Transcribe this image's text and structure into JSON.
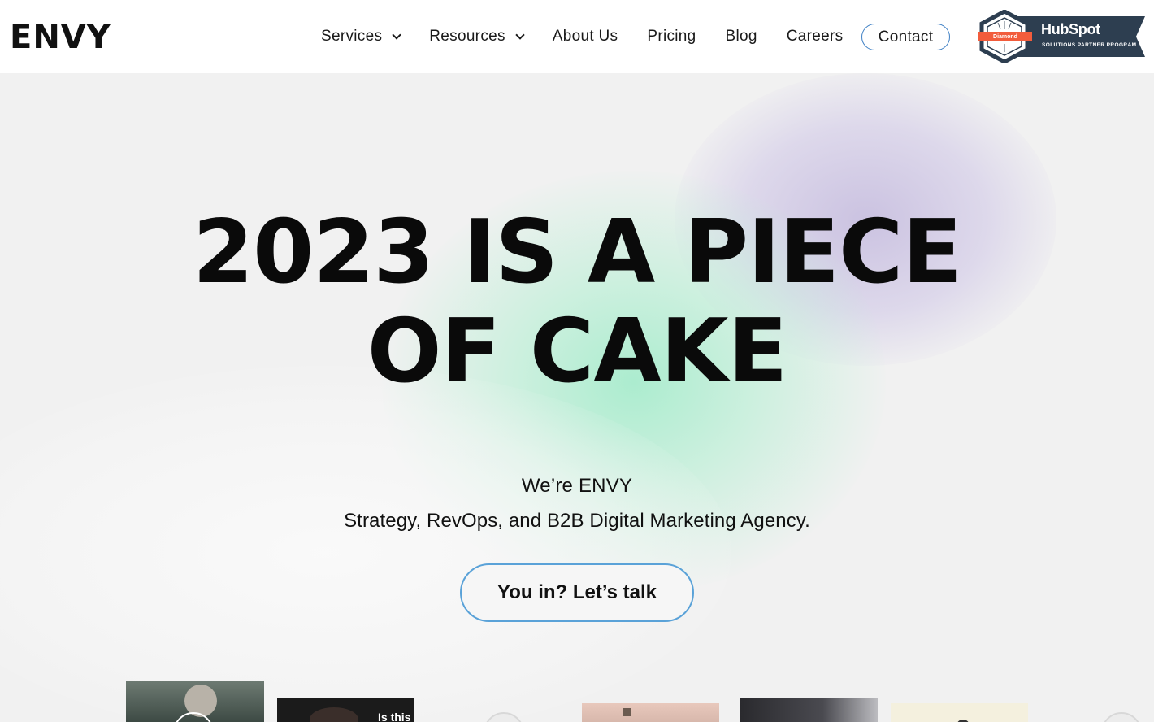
{
  "header": {
    "logo": "ENVY",
    "nav": [
      {
        "label": "Services",
        "has_dropdown": true
      },
      {
        "label": "Resources",
        "has_dropdown": true
      },
      {
        "label": "About Us",
        "has_dropdown": false
      },
      {
        "label": "Pricing",
        "has_dropdown": false
      },
      {
        "label": "Blog",
        "has_dropdown": false
      },
      {
        "label": "Careers",
        "has_dropdown": false
      }
    ],
    "contact_label": "Contact",
    "badge": {
      "title": "HubSpot",
      "tier": "Diamond",
      "subtitle": "SOLUTIONS PARTNER PROGRAM"
    }
  },
  "hero": {
    "headline_line1": "2023 IS A PIECE",
    "headline_line2": "OF CAKE",
    "intro": "We’re ENVY",
    "tagline": "Strategy, RevOps, and B2B Digital Marketing Agency.",
    "cta_label": "You in? Let’s talk"
  },
  "thumbnails": {
    "thumb2_text": "Is this"
  },
  "colors": {
    "accent_outline": "#5aa2d8",
    "contact_outline": "#3d7fc4",
    "badge_dark": "#2d3e50",
    "badge_orange": "#f25c3c",
    "blob_green": "#a8eccd",
    "blob_purple": "#c4bade"
  }
}
